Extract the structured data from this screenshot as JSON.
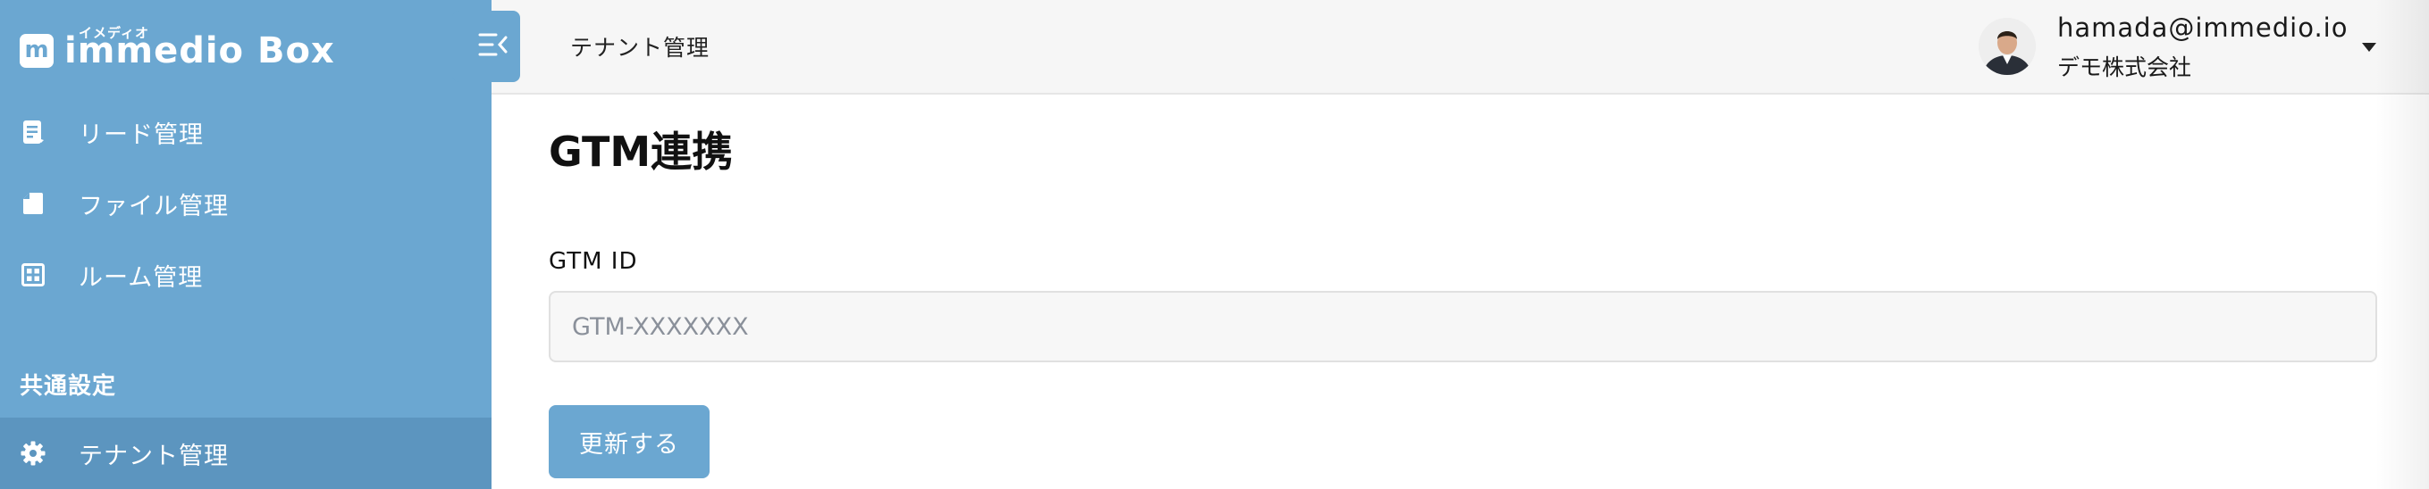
{
  "sidebar": {
    "logo": {
      "mark": "m",
      "kana": "イメディオ",
      "text": "immedio Box"
    },
    "items": [
      {
        "label": "リード管理",
        "icon": "lead-document-icon"
      },
      {
        "label": "ファイル管理",
        "icon": "file-icon"
      },
      {
        "label": "ルーム管理",
        "icon": "room-grid-icon"
      }
    ],
    "section_title": "共通設定",
    "settings_items": [
      {
        "label": "テナント管理",
        "icon": "gear-icon",
        "active": true
      }
    ]
  },
  "header": {
    "breadcrumb": "テナント管理",
    "user": {
      "email": "hamada@immedio.io",
      "company": "デモ株式会社"
    }
  },
  "main": {
    "title": "GTM連携",
    "field_label": "GTM ID",
    "input": {
      "value": "",
      "placeholder": "GTM-XXXXXXX"
    },
    "submit_label": "更新する"
  },
  "colors": {
    "sidebar": "#6ba7d1",
    "sidebar_active": "#5c95bf",
    "accent_button": "#6ba7d1",
    "header_bg": "#f6f6f6"
  }
}
